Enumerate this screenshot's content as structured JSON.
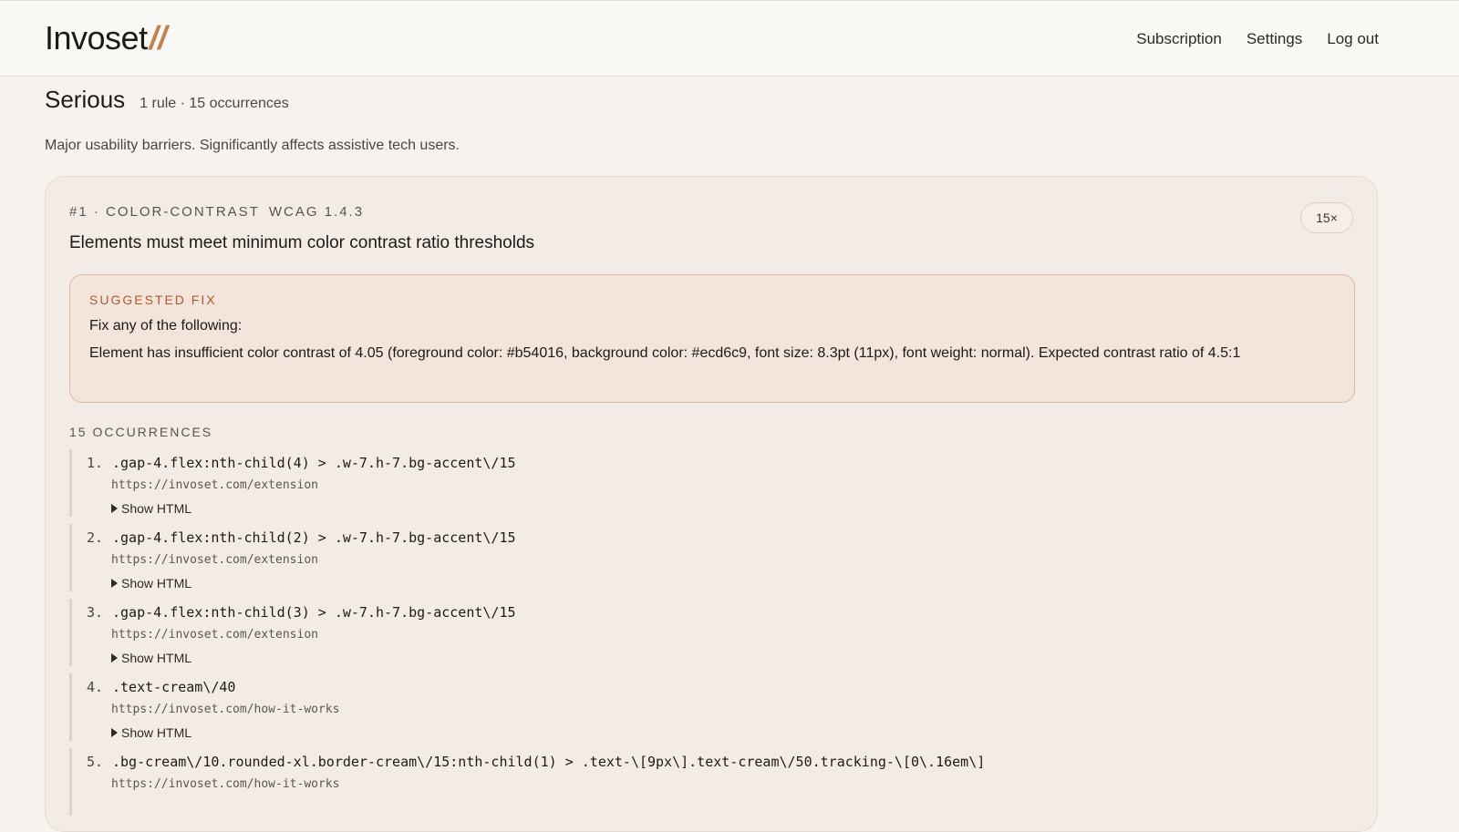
{
  "header": {
    "logo_text": "Invoset",
    "logo_mark": "//",
    "nav": [
      "Subscription",
      "Settings",
      "Log out"
    ]
  },
  "section": {
    "title": "Serious",
    "meta": "1 rule · 15 occurrences",
    "description": "Major usability barriers. Significantly affects assistive tech users."
  },
  "rule": {
    "id": "#1 · COLOR-CONTRAST",
    "wcag": "WCAG 1.4.3",
    "count_badge": "15×",
    "title": "Elements must meet minimum color contrast ratio thresholds",
    "fix_label": "SUGGESTED FIX",
    "fix_intro": "Fix any of the following:",
    "fix_detail": "Element has insufficient color contrast of 4.05 (foreground color: #b54016, background color: #ecd6c9, font size: 8.3pt (11px), font weight: normal). Expected contrast ratio of 4.5:1",
    "occurrences_label": "15 OCCURRENCES",
    "toggle_label": "Show HTML",
    "occurrences": [
      {
        "num": "1.",
        "selector": ".gap-4.flex:nth-child(4) > .w-7.h-7.bg-accent\\/15",
        "url": "https://invoset.com/extension"
      },
      {
        "num": "2.",
        "selector": ".gap-4.flex:nth-child(2) > .w-7.h-7.bg-accent\\/15",
        "url": "https://invoset.com/extension"
      },
      {
        "num": "3.",
        "selector": ".gap-4.flex:nth-child(3) > .w-7.h-7.bg-accent\\/15",
        "url": "https://invoset.com/extension"
      },
      {
        "num": "4.",
        "selector": ".text-cream\\/40",
        "url": "https://invoset.com/how-it-works"
      },
      {
        "num": "5.",
        "selector": ".bg-cream\\/10.rounded-xl.border-cream\\/15:nth-child(1) > .text-\\[9px\\].text-cream\\/50.tracking-\\[0\\.16em\\]",
        "url": "https://invoset.com/how-it-works"
      }
    ]
  },
  "colors": {
    "accent": "#c0824f",
    "fix_label": "#b05a30",
    "fix_border": "#ddb9a5",
    "fix_bg": "#f3e4dc"
  }
}
